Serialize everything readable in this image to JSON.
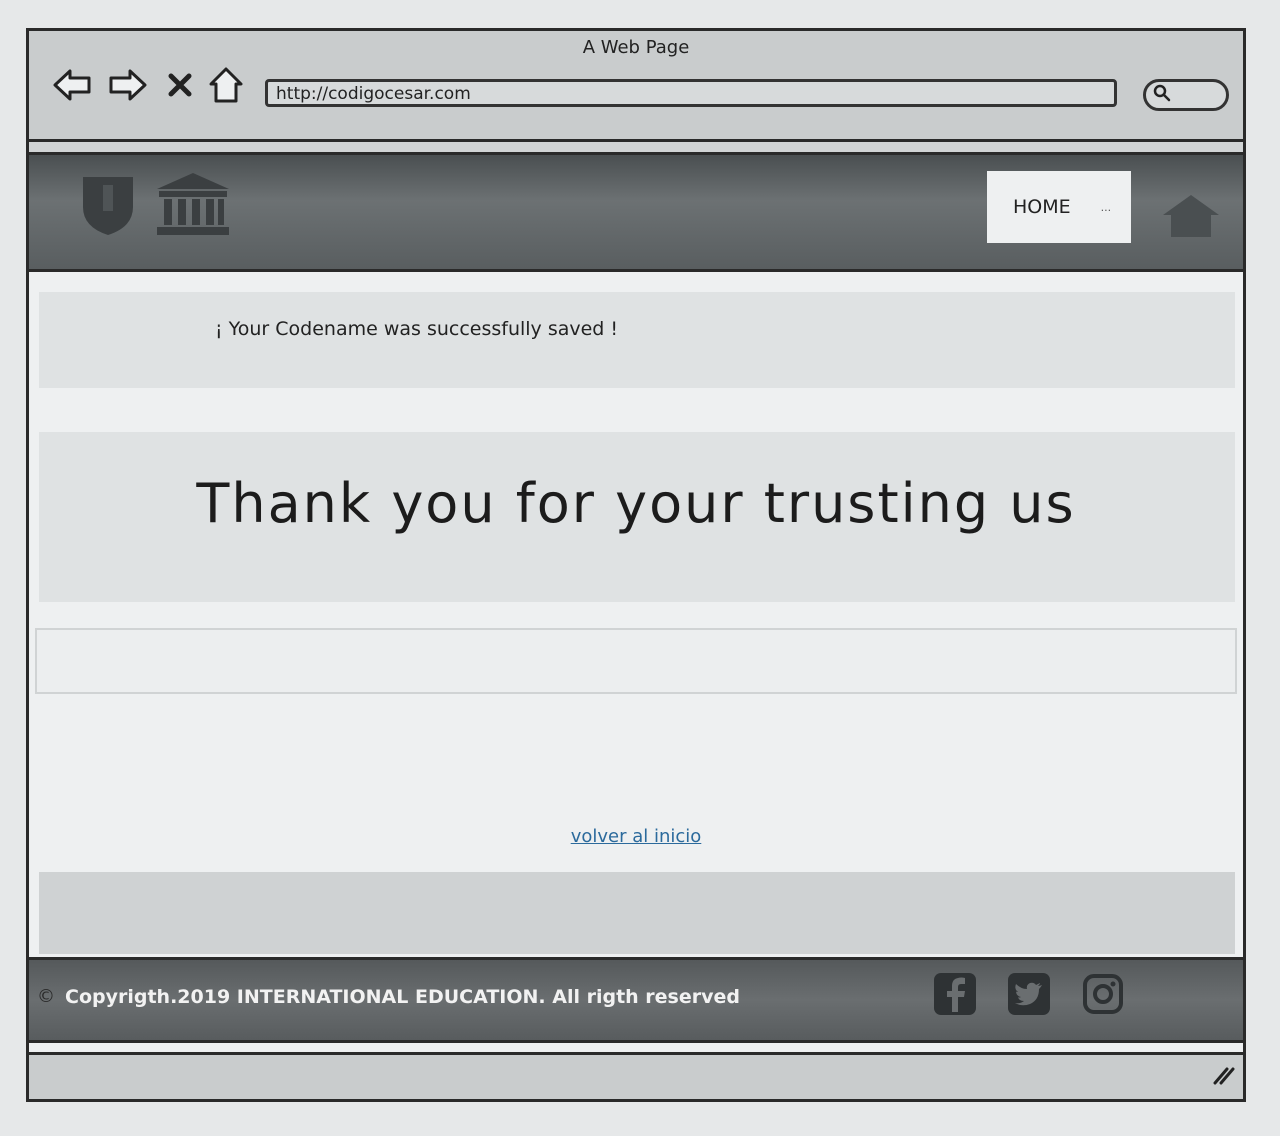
{
  "window": {
    "title": "A Web Page"
  },
  "browser": {
    "url": "http://codigocesar.com",
    "icons": [
      "back-arrow-icon",
      "forward-arrow-icon",
      "close-icon",
      "home-icon",
      "search-icon"
    ]
  },
  "header": {
    "nav": {
      "home_label": "HOME",
      "more_label": "..."
    },
    "icons": [
      "shield-icon",
      "bank-icon",
      "house-icon"
    ]
  },
  "main": {
    "success_message": "¡ Your Codename was successfully saved !",
    "thank_you": "Thank you for your trusting us",
    "back_link": "volver al inicio"
  },
  "footer": {
    "copyright_symbol": "©",
    "copyright_text": "Copyrigth.2019 INTERNATIONAL EDUCATION. All rigth reserved",
    "social_icons": [
      "facebook-icon",
      "twitter-icon",
      "instagram-icon"
    ]
  },
  "colors": {
    "header_bg": "#5f6466",
    "link": "#2b6a9c",
    "band": "#dfe2e3"
  }
}
